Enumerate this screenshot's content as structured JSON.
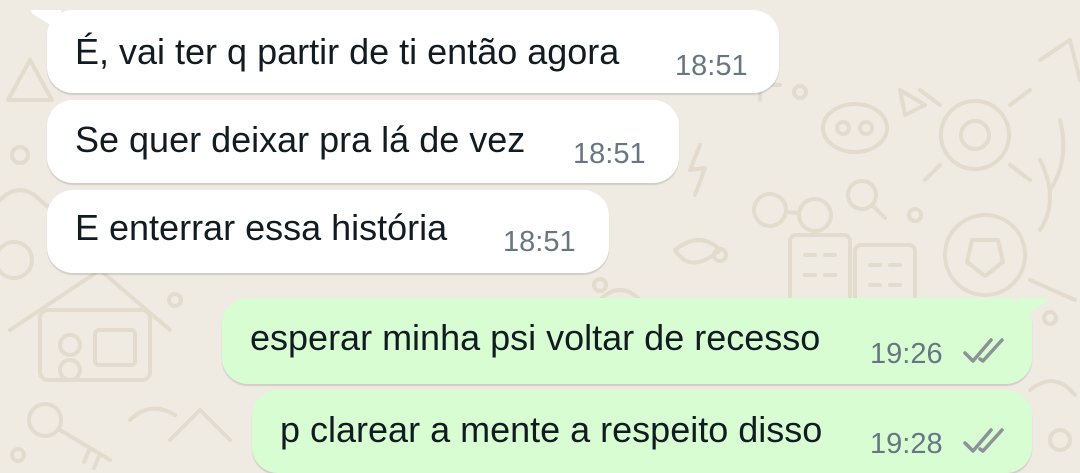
{
  "conversation": {
    "messages": [
      {
        "direction": "incoming",
        "text": "É, vai ter q partir de ti então agora",
        "time": "18:51"
      },
      {
        "direction": "incoming",
        "text": "Se quer deixar pra lá de vez",
        "time": "18:51"
      },
      {
        "direction": "incoming",
        "text": "E enterrar essa história",
        "time": "18:51"
      },
      {
        "direction": "outgoing",
        "text": "esperar minha psi voltar de recesso",
        "time": "19:26",
        "status": "read",
        "status_icon": "double-check-icon"
      },
      {
        "direction": "outgoing",
        "text": "p clarear a mente a respeito disso",
        "time": "19:28",
        "status": "read",
        "status_icon": "double-check-icon"
      }
    ]
  },
  "colors": {
    "wallpaper": "#efeae2",
    "incoming_bubble": "#ffffff",
    "outgoing_bubble": "#d9fdd3",
    "text": "#111b21",
    "timestamp": "#667781",
    "read_ticks": "#8c9296"
  }
}
